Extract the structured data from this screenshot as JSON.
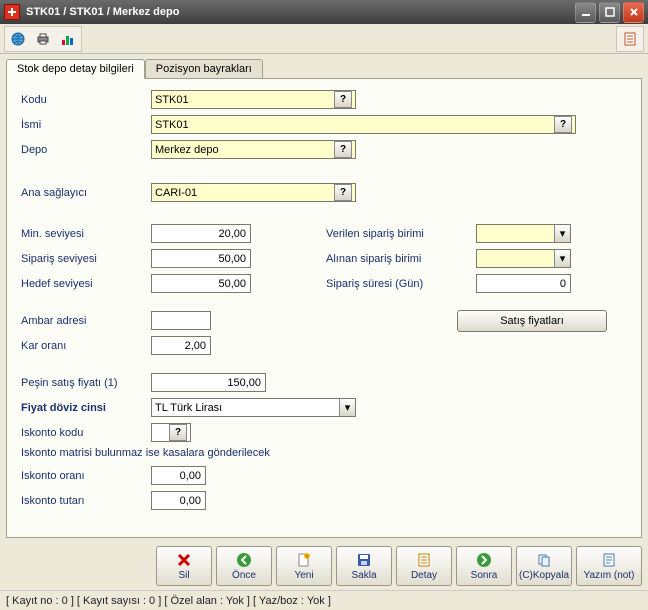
{
  "window": {
    "title": "STK01 / STK01 / Merkez depo"
  },
  "tabs": [
    {
      "label": "Stok depo detay bilgileri",
      "active": true
    },
    {
      "label": "Pozisyon bayrakları",
      "active": false
    }
  ],
  "form": {
    "kodu": {
      "label": "Kodu",
      "value": "STK01"
    },
    "ismi": {
      "label": "İsmi",
      "value": "STK01"
    },
    "depo": {
      "label": "Depo",
      "value": "Merkez depo"
    },
    "ana_saglayici": {
      "label": "Ana sağlayıcı",
      "value": "CARI-01"
    },
    "min_seviyesi": {
      "label": "Min. seviyesi",
      "value": "20,00"
    },
    "siparis_seviyesi": {
      "label": "Sipariş seviyesi",
      "value": "50,00"
    },
    "hedef_seviyesi": {
      "label": "Hedef seviyesi",
      "value": "50,00"
    },
    "verilen_siparis_birimi": {
      "label": "Verilen sipariş birimi",
      "value": ""
    },
    "alinan_siparis_birimi": {
      "label": "Alınan sipariş birimi",
      "value": ""
    },
    "siparis_suresi": {
      "label": "Sipariş süresi (Gün)",
      "value": "0"
    },
    "ambar_adresi": {
      "label": "Ambar adresi",
      "value": ""
    },
    "kar_orani": {
      "label": "Kar oranı",
      "value": "2,00"
    },
    "satis_fiyatlari_btn": "Satış fiyatları",
    "pesin_satis_fiyati": {
      "label": "Peşin satış fiyatı (1)",
      "value": "150,00"
    },
    "fiyat_doviz_cinsi": {
      "label": "Fiyat döviz cinsi",
      "value": "TL  Türk Lirası"
    },
    "iskonto_kodu": {
      "label": "Iskonto kodu",
      "value": ""
    },
    "iskonto_note": "Iskonto matrisi bulunmaz ise kasalara gönderilecek",
    "iskonto_orani": {
      "label": "Iskonto oranı",
      "value": "0,00"
    },
    "iskonto_tutari": {
      "label": "Iskonto tutarı",
      "value": "0,00"
    }
  },
  "actions": {
    "sil": "Sil",
    "once": "Önce",
    "yeni": "Yeni",
    "sakla": "Sakla",
    "detay": "Detay",
    "sonra": "Sonra",
    "kopyala": "(C)Kopyala",
    "yazim": "Yazım (not)"
  },
  "status": "[ Kayıt no : 0 ] [ Kayıt sayısı : 0 ] [ Özel alan : Yok ] [ Yaz/boz : Yok ]",
  "glyphs": {
    "question": "?",
    "dropdown": "▾"
  }
}
